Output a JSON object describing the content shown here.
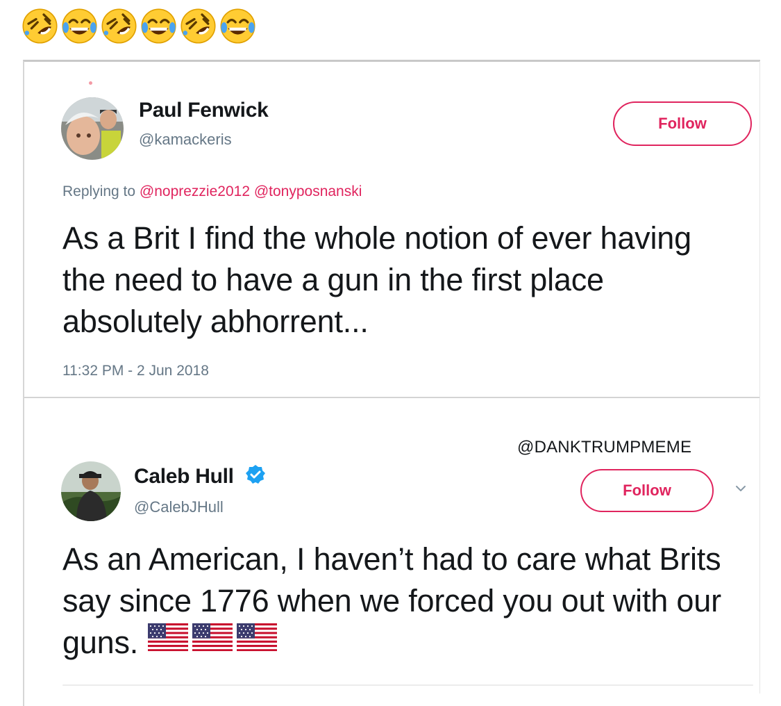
{
  "header": {
    "emojis": [
      "rofl-emoji",
      "joy-emoji",
      "rofl-emoji",
      "joy-emoji",
      "rofl-emoji",
      "joy-emoji"
    ]
  },
  "tweet1": {
    "name": "Paul Fenwick",
    "handle": "@kamackeris",
    "follow_label": "Follow",
    "replying_prefix": "Replying to",
    "replying_mentions": "@noprezzie2012 @tonyposnanski",
    "text": "As a Brit I find the whole notion of ever having the need to have a gun in the first place absolutely abhorrent...",
    "timestamp": "11:32 PM - 2 Jun 2018"
  },
  "watermark": "@DANKTRUMPMEME",
  "tweet2": {
    "name": "Caleb Hull",
    "handle": "@CalebJHull",
    "follow_label": "Follow",
    "verified": true,
    "text": "As an American, I haven’t had to care what Brits say since 1776 when we forced you out with our guns.",
    "emoji": [
      "us-flag",
      "us-flag",
      "us-flag"
    ]
  },
  "colors": {
    "accent": "#e0245e",
    "verified": "#1da1f2",
    "secondary_text": "#657786"
  }
}
